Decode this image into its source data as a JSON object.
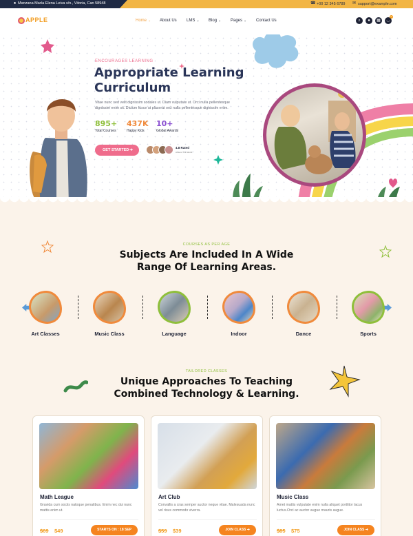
{
  "topbar": {
    "address": "Manzana María Elena Leiva s/n., Vitoria, Can 58948",
    "phone": "+00 12 345 6789",
    "email": "support@example.com"
  },
  "brand": {
    "logo_text": "APPLE"
  },
  "nav": {
    "items": [
      {
        "label": "Home",
        "has_caret": true,
        "active": true
      },
      {
        "label": "About Us",
        "has_caret": false
      },
      {
        "label": "LMS",
        "has_caret": true
      },
      {
        "label": "Blog",
        "has_caret": true
      },
      {
        "label": "Pages",
        "has_caret": true
      },
      {
        "label": "Contact Us",
        "has_caret": false
      }
    ],
    "icons": [
      "search-icon",
      "user-icon",
      "grid-icon",
      "cart-icon"
    ],
    "cart_count": "0"
  },
  "hero": {
    "tagline": "ENCOURAGES LEARNING",
    "title": "Appropriate Learning Curriculum",
    "text": "Vitae nunc sed velit dignissim sodales ut. Diam vulputate ut. Orci nulla pellentesque dignissim enim sit. Dictum fusce ut placerat orci nulla pellentesque dignissim enim.",
    "stats": [
      {
        "value": "895+",
        "label": "Total Courses",
        "color": "#8fbf3b"
      },
      {
        "value": "437K",
        "label": "Happy Kids",
        "color": "#f08a3c"
      },
      {
        "value": "10+",
        "label": "Global Awards",
        "color": "#8a4fd1"
      }
    ],
    "cta_label": "GET STARTED",
    "rating_value": "4.8 Rated",
    "rating_sub": "Around The World"
  },
  "subjects": {
    "eyebrow": "COURSES AS PER AGE",
    "title_line1": "Subjects Are Included In A Wide",
    "title_line2": "Range Of Learning Areas.",
    "items": [
      {
        "label": "Art Classes",
        "border": "#f08a3c",
        "fill": "#c9d9b9"
      },
      {
        "label": "Music Class",
        "border": "#f08a3c",
        "fill": "#d9c3a8"
      },
      {
        "label": "Language",
        "border": "#8fbf3b",
        "fill": "#b8c4c9"
      },
      {
        "label": "Indoor",
        "border": "#f08a3c",
        "fill": "#e3b8c2"
      },
      {
        "label": "Dance",
        "border": "#f08a3c",
        "fill": "#d8d0c2"
      },
      {
        "label": "Sports",
        "border": "#8fbf3b",
        "fill": "#cfd8b5"
      }
    ]
  },
  "classes": {
    "eyebrow": "TAILORED CLASSES",
    "title_line1": "Unique Approaches To Teaching",
    "title_line2": "Combined Technology & Learning.",
    "cards": [
      {
        "title": "Math League",
        "desc": "Gravida cum sociis natoque penatibus. Enim nec dui nunc mattis enim ut.",
        "price_old": "$69",
        "price_new": "$49",
        "button": "STARTS ON : 18 SEP",
        "img": "linear-gradient(135deg,#8fb6d6 0%,#d59b6a 30%,#7fb44c 55%,#e04b7c 75%,#4c8ad0 100%)"
      },
      {
        "title": "Art Club",
        "desc": "Convallis a cras semper auctor neque vitae. Malesuada nunc vel risus commodo viverra.",
        "price_old": "$59",
        "price_new": "$39",
        "button": "JOIN CLASS",
        "img": "linear-gradient(135deg,#d7dfe8 0%,#e9ecef 40%,#d2a055 62%,#e2a93c 80%,#cfd6dc 100%)"
      },
      {
        "title": "Music Class",
        "desc": "Amet mattis vulputate enim nulla aliquet porttitor lacus luctus.Orci ac auctor augue mauris augue.",
        "price_old": "$85",
        "price_new": "$75",
        "button": "JOIN CLASS",
        "img": "linear-gradient(135deg,#bda78a 0%,#3b6bb0 35%,#c97b3c 55%,#7a9a4e 75%,#d8c4a0 100%)"
      }
    ]
  }
}
